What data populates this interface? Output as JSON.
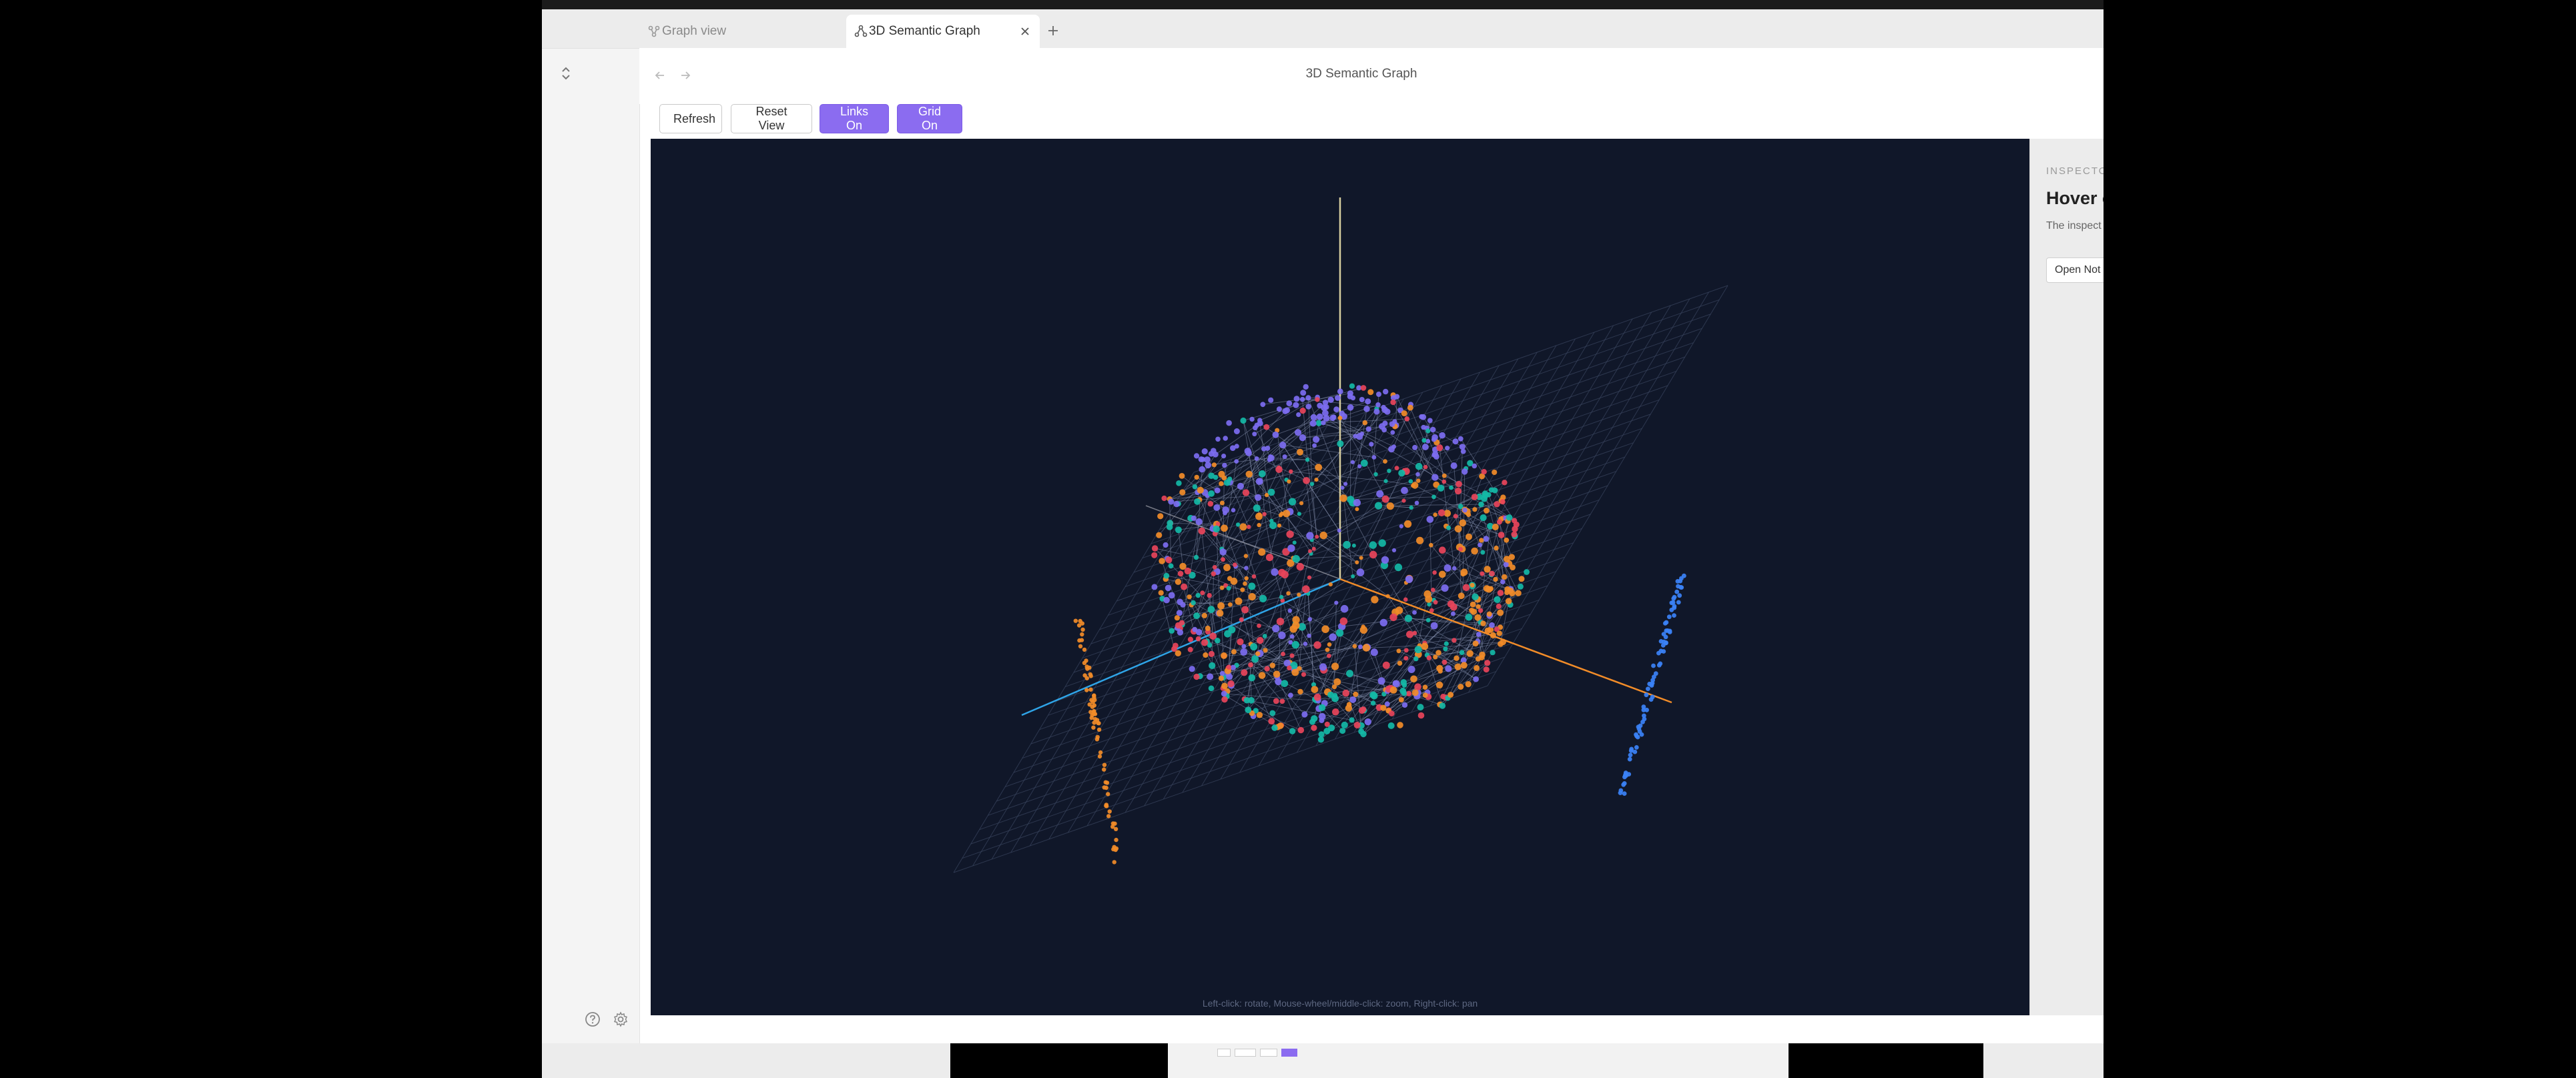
{
  "app": {
    "tabs": [
      {
        "label": "Graph view",
        "icon": "graph-icon",
        "active": false
      },
      {
        "label": "3D Semantic Graph",
        "icon": "network-icon",
        "active": true
      }
    ],
    "new_tab_icon": "plus-icon",
    "page_title": "3D Semantic Graph"
  },
  "nav": {
    "back_icon": "arrow-left-icon",
    "forward_icon": "arrow-right-icon"
  },
  "toolbar": {
    "refresh_label": "Refresh",
    "reset_label": "Reset View",
    "links_label": "Links On",
    "grid_label": "Grid On",
    "accent": "#8b6cf0"
  },
  "canvas": {
    "background": "#101729",
    "hint": "Left-click: rotate, Mouse-wheel/middle-click: zoom, Right-click: pan",
    "node_colors": [
      "#7c6cf0",
      "#e8445a",
      "#14b8a6",
      "#f28c28",
      "#3b82f6"
    ],
    "axis_colors": {
      "x": "#f28c28",
      "y": "#d8cfa0",
      "z": "#2fa4e7"
    }
  },
  "inspector": {
    "label": "INSPECTO",
    "title": "Hover o",
    "description": "The inspect re.",
    "button_label": "Open Not"
  },
  "rail": {
    "help_icon": "help-icon",
    "settings_icon": "gear-icon",
    "collapse_icon": "chevron-updown-icon"
  }
}
